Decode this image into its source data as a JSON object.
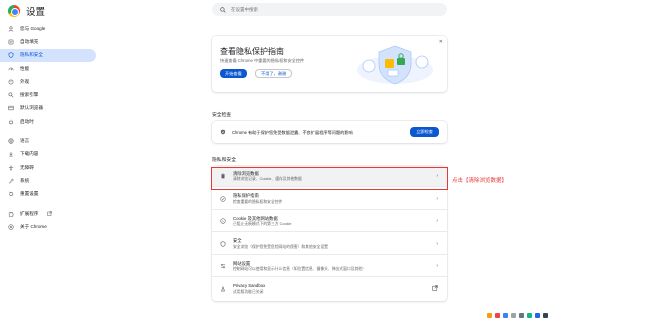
{
  "header": {
    "title": "设置",
    "search_placeholder": "在设置中搜索"
  },
  "sidebar": {
    "items": [
      {
        "label": "您与 Google",
        "icon": "person-icon"
      },
      {
        "label": "自动填充",
        "icon": "autofill-icon"
      },
      {
        "label": "隐私和安全",
        "icon": "shield-icon",
        "active": true
      },
      {
        "label": "性能",
        "icon": "performance-icon"
      },
      {
        "label": "外观",
        "icon": "palette-icon"
      },
      {
        "label": "搜索引擎",
        "icon": "search-icon"
      },
      {
        "label": "默认浏览器",
        "icon": "browser-icon"
      },
      {
        "label": "启动时",
        "icon": "power-icon"
      },
      {
        "label": "语言",
        "icon": "globe-icon"
      },
      {
        "label": "下载内容",
        "icon": "download-icon"
      },
      {
        "label": "无障碍",
        "icon": "accessibility-icon"
      },
      {
        "label": "系统",
        "icon": "wrench-icon"
      },
      {
        "label": "重置设置",
        "icon": "reset-icon"
      },
      {
        "label": "扩展程序",
        "icon": "extension-icon",
        "external": true
      },
      {
        "label": "关于 Chrome",
        "icon": "chrome-icon"
      }
    ]
  },
  "promo": {
    "title": "查看隐私保护指南",
    "description": "快速查看 Chrome 中重要的隐私权和安全控件",
    "primary_label": "开始查看",
    "secondary_label": "不用了，谢谢"
  },
  "safety": {
    "heading": "安全检查",
    "text": "Chrome 有助于保护您免受数据泄露、不良扩展程序等问题的影响",
    "button_label": "立即检查"
  },
  "privacy": {
    "heading": "隐私和安全",
    "rows": [
      {
        "title": "清除浏览数据",
        "subtitle": "清除浏览记录、Cookie、缓存及其他数据",
        "icon": "trash-icon",
        "highlight": true
      },
      {
        "title": "隐私保护指南",
        "subtitle": "检查重要的隐私权和安全控件",
        "icon": "guide-icon"
      },
      {
        "title": "Cookie 及其他网站数据",
        "subtitle": "已阻止无痕模式下的第三方 Cookie",
        "icon": "cookie-icon"
      },
      {
        "title": "安全",
        "subtitle": "安全浏览（保护您免受危险网站的侵害）和其他安全设置",
        "icon": "security-icon"
      },
      {
        "title": "网站设置",
        "subtitle": "控制网站可以使用和显示什么信息（如位置信息、摄像头、弹出式窗口及其他）",
        "icon": "site-settings-icon"
      },
      {
        "title": "Privacy Sandbox",
        "subtitle": "试用版功能已关闭",
        "icon": "sandbox-icon",
        "external": true
      }
    ]
  },
  "annotation": "点击【清除浏览数据】",
  "colors": {
    "accent": "#0b57d0",
    "active_bg": "#d3e3fd",
    "annotation_red": "#e53935"
  }
}
